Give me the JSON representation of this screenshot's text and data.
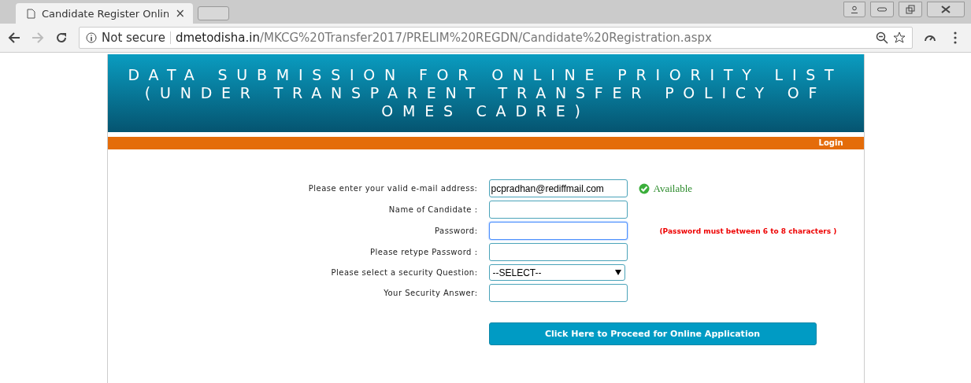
{
  "browser": {
    "tab": {
      "title": "Candidate Register Onlin",
      "close": "×"
    },
    "security": "Not secure",
    "url_host": "dmetodisha.in",
    "url_path": "/MKCG%20Transfer2017/PRELIM%20REGDN/Candidate%20Registration.aspx"
  },
  "header": {
    "title": "DATA SUBMISSION FOR ONLINE PRIORITY LIST (UNDER TRANSPARENT TRANSFER POLICY OF OMES CADRE)"
  },
  "nav": {
    "login": "Login"
  },
  "form": {
    "fields": [
      {
        "kind": "text",
        "label": "Please enter your valid e-mail address:",
        "value": "pcpradhan@rediffmail.com",
        "focused": false,
        "status": "Available"
      },
      {
        "kind": "text",
        "label": "Name of Candidate :",
        "focused": false
      },
      {
        "kind": "text",
        "label": "Password:",
        "focused": true,
        "hint": "(Password must between 6 to 8 characters )"
      },
      {
        "kind": "text",
        "label": "Please retype Password :",
        "focused": false
      },
      {
        "kind": "select",
        "label": "Please select a security Question:",
        "value": "--SELECT--",
        "focused": false
      },
      {
        "kind": "text",
        "label": "Your Security Answer:",
        "focused": false
      }
    ],
    "submit": "Click Here to Proceed for Online Application"
  }
}
